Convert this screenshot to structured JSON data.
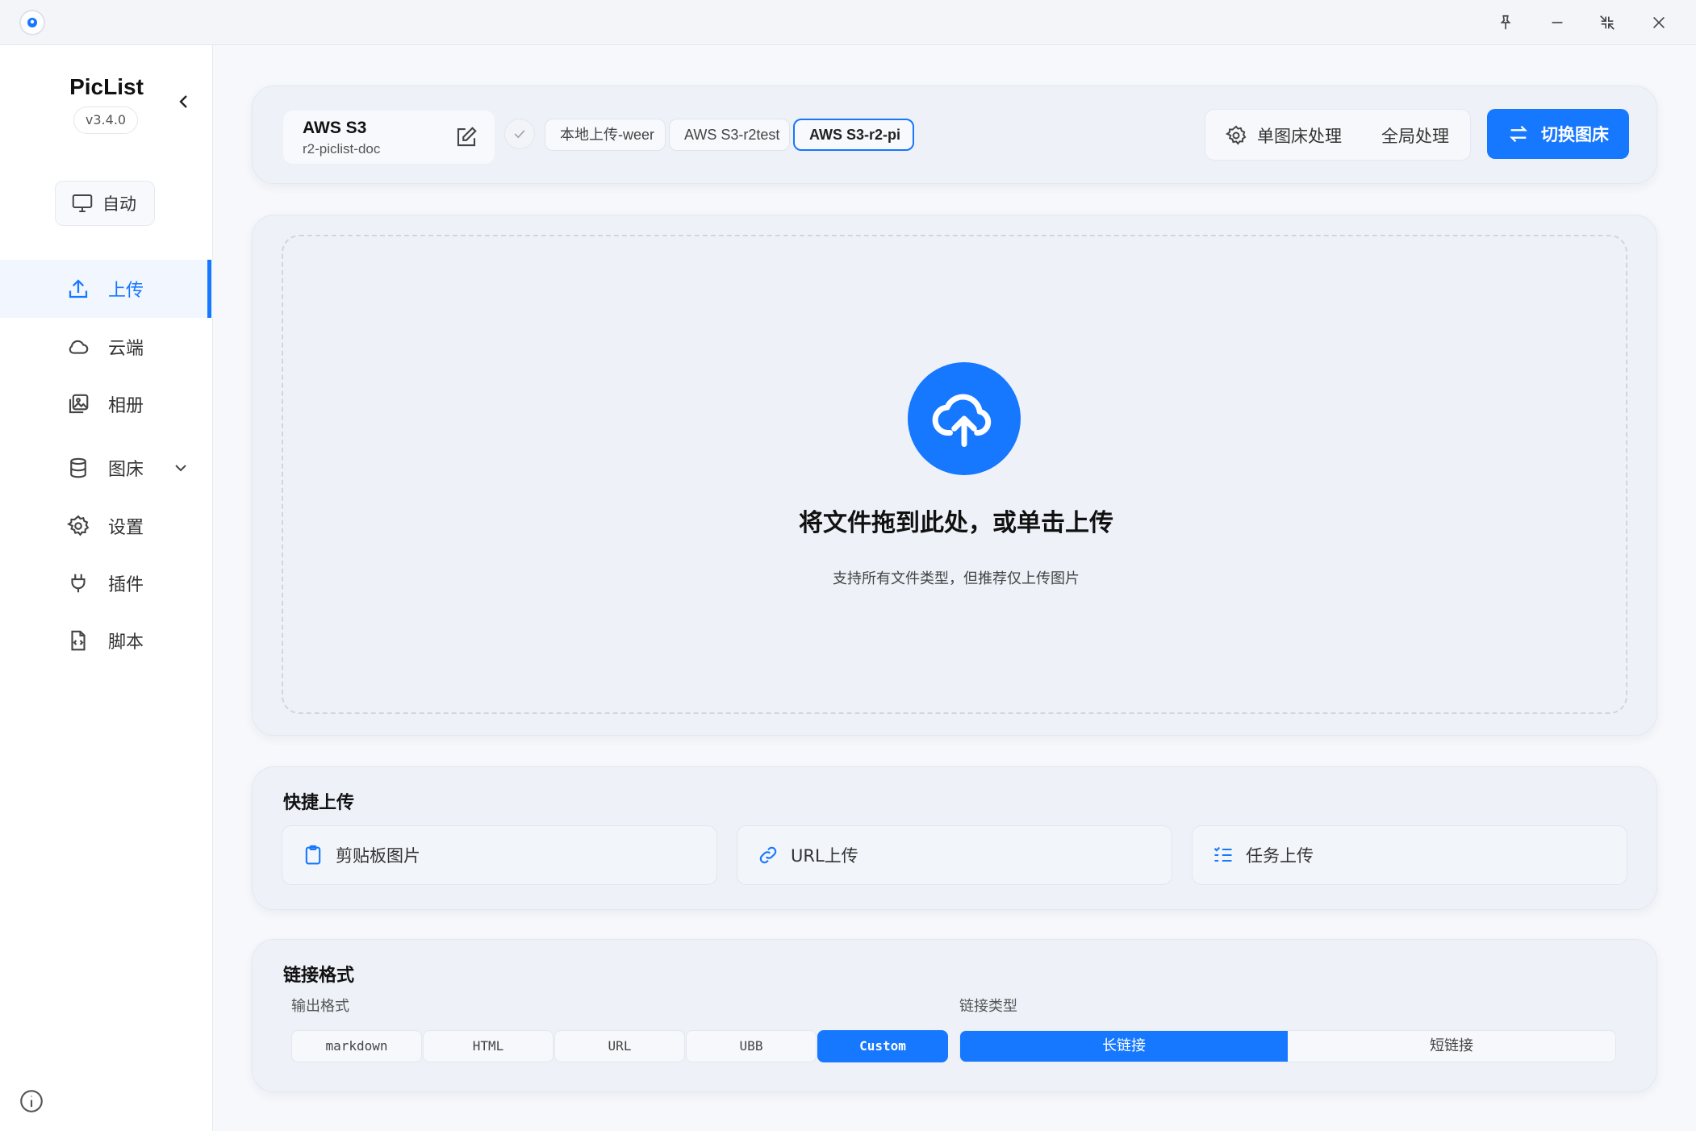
{
  "app": {
    "name": "PicList",
    "version": "v3.4.0"
  },
  "sidebar": {
    "theme_label": "自动",
    "items": [
      {
        "label": "上传",
        "icon": "upload-icon",
        "active": true
      },
      {
        "label": "云端",
        "icon": "cloud-icon"
      },
      {
        "label": "相册",
        "icon": "gallery-icon"
      },
      {
        "label": "图床",
        "icon": "database-icon"
      },
      {
        "label": "设置",
        "icon": "gear-icon"
      },
      {
        "label": "插件",
        "icon": "plug-icon"
      },
      {
        "label": "脚本",
        "icon": "script-file-icon"
      }
    ]
  },
  "header": {
    "picbed_name": "AWS S3",
    "picbed_config": "r2-piclist-doc",
    "config_tabs": [
      "本地上传-weer",
      "AWS S3-r2test",
      "AWS S3-r2-pi"
    ],
    "selected_tab": 2,
    "single_process_label": "单图床处理",
    "global_process_label": "全局处理",
    "switch_label": "切换图床"
  },
  "dropzone": {
    "title": "将文件拖到此处，或单击上传",
    "subtitle": "支持所有文件类型，但推荐仅上传图片"
  },
  "quick_upload": {
    "title": "快捷上传",
    "buttons": [
      {
        "label": "剪贴板图片",
        "icon": "clipboard-icon"
      },
      {
        "label": "URL上传",
        "icon": "link-icon"
      },
      {
        "label": "任务上传",
        "icon": "task-list-icon"
      }
    ]
  },
  "link_format": {
    "title": "链接格式",
    "output_label": "输出格式",
    "type_label": "链接类型",
    "formats": [
      "markdown",
      "HTML",
      "URL",
      "UBB",
      "Custom"
    ],
    "selected_format": "Custom",
    "link_types": [
      "长链接",
      "短链接"
    ],
    "selected_link_type": "长链接"
  },
  "colors": {
    "accent": "#1677ff",
    "background": "#f6f8fb",
    "card": "#eef2f8"
  }
}
